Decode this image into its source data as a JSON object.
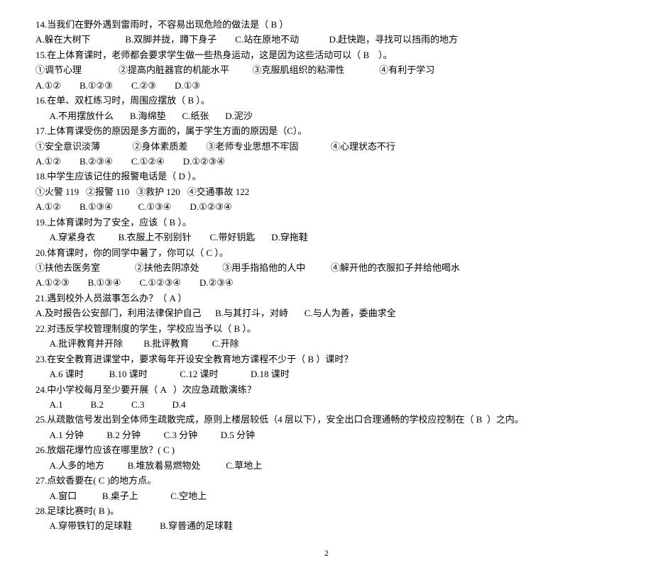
{
  "lines": [
    "14.当我们在野外遇到雷雨时，不容易出现危险的做法是（ B ）",
    "A.躲在大树下               B.双脚并拢，蹲下身子        C.站在原地不动             D.赶快跑，寻找可以挡雨的地方",
    "15.在上体育课时，老师都会要求学生做一些热身运动，这是因为这些活动可以（ B    ）。",
    "①调节心理                ②提高内脏器官的机能水平          ③克服肌组织的粘滞性               ④有利于学习",
    "A.①②        B.①②③        C.②③        D.①③",
    "16.在单、双杠练习时，周围应摆放（ B ）。",
    "      A.不用摆放什么       B.海绵垫       C.纸张       D.泥沙",
    "17.上体育课受伤的原因是多方面的，属于学生方面的原因是（C）。",
    "①安全意识淡薄              ②身体素质差        ③老师专业思想不牢固              ④心理状态不行",
    "A.①②        B.②③④        C.①②④        D.①②③④",
    "18.中学生应该记住的报警电话是（ D ）。",
    "①火警 119   ②报警 110   ③救护 120   ④交通事故 122",
    "A.①②        B.①③④           C.①③④        D.①②③④",
    "19.上体育课时为了安全，应该（ B ）。",
    "      A.穿紧身衣          B.衣服上不别别针        C.带好钥匙       D.穿拖鞋",
    "20.体育课时，你的同学中暑了，你可以（ C ）。",
    "①扶他去医务室               ②扶他去阴凉处          ③用手指掐他的人中           ④解开他的衣服扣子并给他喝水",
    "A.①②③        B.①③④        C.①②③④        D.②③④",
    "21.遇到校外人员滋事怎么办？（ A ）",
    "A.及时报告公安部门，利用法律保护自己      B.与其打斗，对峙       C.与人为善，委曲求全",
    "22.对违反学校管理制度的学生，学校应当予以（ B ）。",
    "      A.批评教育并开除         B.批评教育          C.开除",
    "23.在安全教育进课堂中，要求每年开设安全教育地方课程不少于（ B ）课时？",
    "      A.6 课时           B.10 课时              C.12 课时              D.18 课时",
    "24.中小学校每月至少要开展（ A   ）次应急疏散演练？",
    "      A.1            B.2            C.3            D.4",
    "25.从疏散信号发出到全体师生疏散完成，原则上楼层较低（4 层以下），安全出口合理通畅的学校应控制在（ B  ）之内。",
    "      A.1 分钟          B.2 分钟          C.3 分钟          D.5 分钟",
    "26.放烟花爆竹应该在哪里放？( C )",
    "      A.人多的地方          B.堆放着易燃物处           C.草地上",
    "27.点蚊香要在( C )的地方点。",
    "      A.窗口           B.桌子上              C.空地上",
    "28.足球比赛时( B )。",
    "      A.穿带铁钉的足球鞋            B.穿普通的足球鞋"
  ],
  "pageNumber": "2"
}
